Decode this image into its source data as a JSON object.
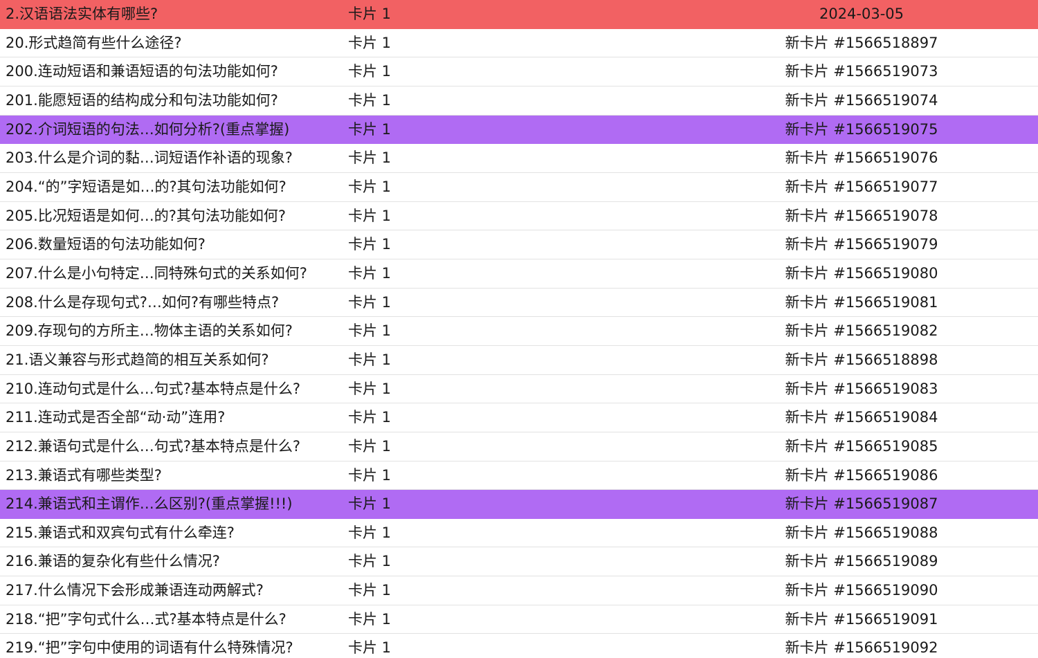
{
  "rows": [
    {
      "question": "2.汉语语法实体有哪些?",
      "card": "卡片 1",
      "due": "2024-03-05",
      "flag": "red"
    },
    {
      "question": "20.形式趋简有些什么途径?",
      "card": "卡片 1",
      "due": "新卡片 #1566518897",
      "flag": "none"
    },
    {
      "question": "200.连动短语和兼语短语的句法功能如何?",
      "card": "卡片 1",
      "due": "新卡片 #1566519073",
      "flag": "none"
    },
    {
      "question": "201.能愿短语的结构成分和句法功能如何?",
      "card": "卡片 1",
      "due": "新卡片 #1566519074",
      "flag": "none"
    },
    {
      "question": "202.介词短语的句法…如何分析?(重点掌握)",
      "card": "卡片 1",
      "due": "新卡片 #1566519075",
      "flag": "purple"
    },
    {
      "question": "203.什么是介词的黏…词短语作补语的现象?",
      "card": "卡片 1",
      "due": "新卡片 #1566519076",
      "flag": "none"
    },
    {
      "question": "204.“的”字短语是如…的?其句法功能如何?",
      "card": "卡片 1",
      "due": "新卡片 #1566519077",
      "flag": "none"
    },
    {
      "question": "205.比况短语是如何…的?其句法功能如何?",
      "card": "卡片 1",
      "due": "新卡片 #1566519078",
      "flag": "none"
    },
    {
      "question": "206.数量短语的句法功能如何?",
      "card": "卡片 1",
      "due": "新卡片 #1566519079",
      "flag": "none"
    },
    {
      "question": "207.什么是小句特定…同特殊句式的关系如何?",
      "card": "卡片 1",
      "due": "新卡片 #1566519080",
      "flag": "none"
    },
    {
      "question": "208.什么是存现句式?…如何?有哪些特点?",
      "card": "卡片 1",
      "due": "新卡片 #1566519081",
      "flag": "none"
    },
    {
      "question": "209.存现句的方所主…物体主语的关系如何?",
      "card": "卡片 1",
      "due": "新卡片 #1566519082",
      "flag": "none"
    },
    {
      "question": "21.语义兼容与形式趋简的相互关系如何?",
      "card": "卡片 1",
      "due": "新卡片 #1566518898",
      "flag": "none"
    },
    {
      "question": "210.连动句式是什么…句式?基本特点是什么?",
      "card": "卡片 1",
      "due": "新卡片 #1566519083",
      "flag": "none"
    },
    {
      "question": "211.连动式是否全部“动·动”连用?",
      "card": "卡片 1",
      "due": "新卡片 #1566519084",
      "flag": "none"
    },
    {
      "question": "212.兼语句式是什么…句式?基本特点是什么?",
      "card": "卡片 1",
      "due": "新卡片 #1566519085",
      "flag": "none"
    },
    {
      "question": "213.兼语式有哪些类型?",
      "card": "卡片 1",
      "due": "新卡片 #1566519086",
      "flag": "none"
    },
    {
      "question": "214.兼语式和主谓作…么区别?(重点掌握!!!)",
      "card": "卡片 1",
      "due": "新卡片 #1566519087",
      "flag": "purple"
    },
    {
      "question": "215.兼语式和双宾句式有什么牵连?",
      "card": "卡片 1",
      "due": "新卡片 #1566519088",
      "flag": "none"
    },
    {
      "question": "216.兼语的复杂化有些什么情况?",
      "card": "卡片 1",
      "due": "新卡片 #1566519089",
      "flag": "none"
    },
    {
      "question": "217.什么情况下会形成兼语连动两解式?",
      "card": "卡片 1",
      "due": "新卡片 #1566519090",
      "flag": "none"
    },
    {
      "question": "218.“把”字句式什么…式?基本特点是什么?",
      "card": "卡片 1",
      "due": "新卡片 #1566519091",
      "flag": "none"
    },
    {
      "question": "219.“把”字句中使用的词语有什么特殊情况?",
      "card": "卡片 1",
      "due": "新卡片 #1566519092",
      "flag": "none"
    }
  ],
  "colors": {
    "flag_red": "#f26163",
    "flag_purple": "#b06bf3",
    "row_border": "#e2e2e2",
    "text": "#1a1a1a"
  }
}
